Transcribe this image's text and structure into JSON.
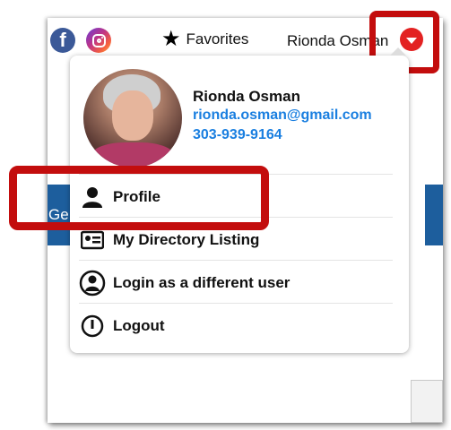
{
  "topbar": {
    "facebook_letter": "f",
    "favorites_label": "Favorites",
    "user_display": "Rionda Osman"
  },
  "background": {
    "banner_text": "Ge"
  },
  "dropdown": {
    "name": "Rionda Osman",
    "email": "rionda.osman@gmail.com",
    "phone": "303-939-9164",
    "items": [
      {
        "label": "Profile",
        "icon": "person-icon"
      },
      {
        "label": "My Directory Listing",
        "icon": "directory-card-icon"
      },
      {
        "label": "Login as a different user",
        "icon": "switch-user-icon"
      },
      {
        "label": "Logout",
        "icon": "power-icon"
      }
    ]
  },
  "colors": {
    "highlight": "#c30d0d",
    "accent_link": "#1a7fe0",
    "toggle": "#e32222",
    "banner": "#1d5e9d"
  }
}
